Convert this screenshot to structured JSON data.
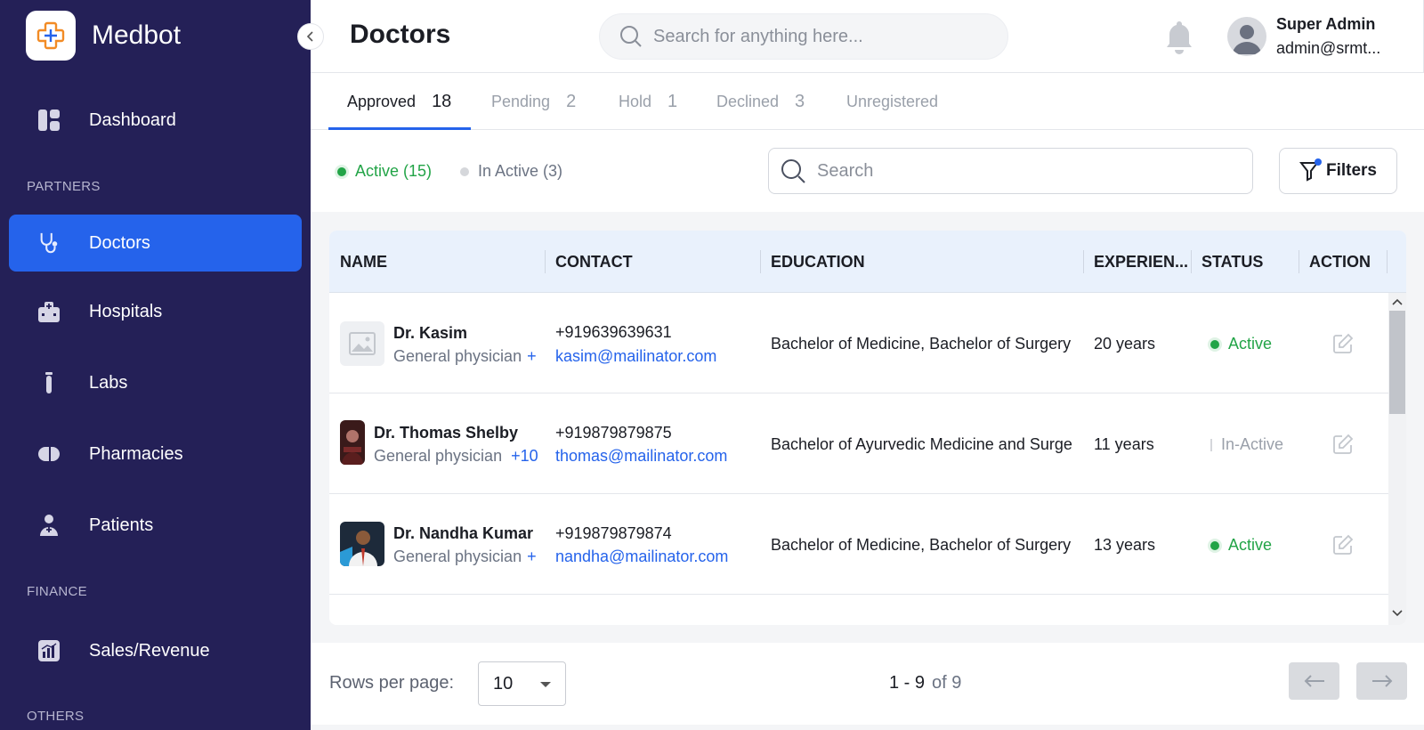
{
  "app": {
    "name": "Medbot"
  },
  "sidebar": {
    "items": [
      {
        "label": "Dashboard",
        "icon": "dashboard-icon"
      },
      {
        "label": "Doctors",
        "icon": "stethoscope-icon",
        "active": true
      },
      {
        "label": "Hospitals",
        "icon": "hospital-icon"
      },
      {
        "label": "Labs",
        "icon": "test-tube-icon"
      },
      {
        "label": "Pharmacies",
        "icon": "pill-icon"
      },
      {
        "label": "Patients",
        "icon": "patient-icon"
      },
      {
        "label": "Sales/Revenue",
        "icon": "chart-icon"
      }
    ],
    "sections": {
      "partners": "PARTNERS",
      "finance": "FINANCE",
      "others": "OTHERS"
    }
  },
  "header": {
    "title": "Doctors",
    "search_placeholder": "Search for anything here...",
    "user_name": "Super Admin",
    "user_email": "admin@srmt..."
  },
  "tabs": [
    {
      "label": "Approved",
      "count": "18"
    },
    {
      "label": "Pending",
      "count": "2"
    },
    {
      "label": "Hold",
      "count": "1"
    },
    {
      "label": "Declined",
      "count": "3"
    },
    {
      "label": "Unregistered",
      "count": ""
    }
  ],
  "filters": {
    "active_chip": "Active (15)",
    "inactive_chip": "In Active (3)",
    "search_placeholder": "Search",
    "filters_button": "Filters"
  },
  "table": {
    "columns": [
      "NAME",
      "CONTACT",
      "EDUCATION",
      "EXPERIEN...",
      "STATUS",
      "ACTION"
    ],
    "rows": [
      {
        "name": "Dr. Kasim",
        "specialty": "General physician",
        "more": "+",
        "phone": "+919639639631",
        "email": "kasim@mailinator.com",
        "education": "Bachelor of Medicine, Bachelor of Surgery",
        "experience": "20 years",
        "status": "Active"
      },
      {
        "name": "Dr. Thomas Shelby",
        "specialty": "General physician",
        "more": "+10",
        "phone": "+919879879875",
        "email": "thomas@mailinator.com",
        "education": "Bachelor of Ayurvedic Medicine and Surge",
        "experience": "11 years",
        "status": "In-Active"
      },
      {
        "name": "Dr. Nandha Kumar",
        "specialty": "General physician",
        "more": "+",
        "phone": "+919879879874",
        "email": "nandha@mailinator.com",
        "education": "Bachelor of Medicine, Bachelor of Surgery",
        "experience": "13 years",
        "status": "Active"
      }
    ]
  },
  "pagination": {
    "rows_per_page_label": "Rows per page:",
    "rows_per_page_value": "10",
    "range": "1 - 9",
    "of": "of 9"
  },
  "colors": {
    "sidebar_bg": "#242057",
    "accent": "#2563eb",
    "active_green": "#22a447"
  }
}
